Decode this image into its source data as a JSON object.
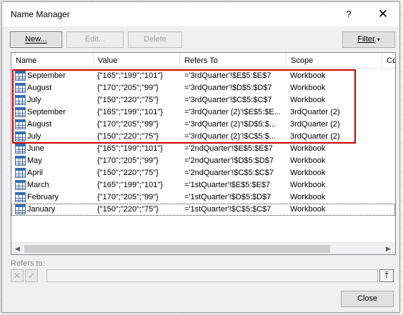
{
  "dialog": {
    "title": "Name Manager",
    "help_label": "?",
    "close_glyph": "✕"
  },
  "toolbar": {
    "new_label": "New...",
    "edit_label": "Edit...",
    "delete_label": "Delete",
    "filter_label": "Filter"
  },
  "columns": [
    "Name",
    "Value",
    "Refers To",
    "Scope",
    "Comment"
  ],
  "rows": [
    {
      "name": "September",
      "value": "{\"165\";\"199\";\"101\"}",
      "refers_to": "='3rdQuarter'!$E$5:$E$7",
      "scope": "Workbook"
    },
    {
      "name": "August",
      "value": "{\"170\";\"205\";\"99\"}",
      "refers_to": "='3rdQuarter'!$D$5:$D$7",
      "scope": "Workbook"
    },
    {
      "name": "July",
      "value": "{\"150\";\"220\";\"75\"}",
      "refers_to": "='3rdQuarter'!$C$5:$C$7",
      "scope": "Workbook"
    },
    {
      "name": "September",
      "value": "{\"165\";\"199\";\"101\"}",
      "refers_to": "='3rdQuarter (2)'!$E$5:$E...",
      "scope": "3rdQuarter (2)"
    },
    {
      "name": "August",
      "value": "{\"170\";\"205\";\"99\"}",
      "refers_to": "='3rdQuarter (2)'!$D$5:$...",
      "scope": "3rdQuarter (2)"
    },
    {
      "name": "July",
      "value": "{\"150\";\"220\";\"75\"}",
      "refers_to": "='3rdQuarter (2)'!$C$5:$...",
      "scope": "3rdQuarter (2)"
    },
    {
      "name": "June",
      "value": "{\"165\";\"199\";\"101\"}",
      "refers_to": "='2ndQuarter'!$E$5:$E$7",
      "scope": "Workbook"
    },
    {
      "name": "May",
      "value": "{\"170\";\"205\";\"99\"}",
      "refers_to": "='2ndQuarter'!$D$5:$D$7",
      "scope": "Workbook"
    },
    {
      "name": "April",
      "value": "{\"150\";\"220\";\"75\"}",
      "refers_to": "='2ndQuarter'!$C$5:$C$7",
      "scope": "Workbook"
    },
    {
      "name": "March",
      "value": "{\"165\";\"199\";\"101\"}",
      "refers_to": "='1stQuarter'!$E$5:$E$7",
      "scope": "Workbook"
    },
    {
      "name": "February",
      "value": "{\"170\";\"205\";\"99\"}",
      "refers_to": "='1stQuarter'!$D$5:$D$7",
      "scope": "Workbook"
    },
    {
      "name": "January",
      "value": "{\"150\";\"220\";\"75\"}",
      "refers_to": "='1stQuarter'!$C$5:$C$7",
      "scope": "Workbook"
    }
  ],
  "highlight_color": "#cc0000",
  "refers_to_label": "Refers to:",
  "refers_to_value": "",
  "close_button_label": "Close"
}
